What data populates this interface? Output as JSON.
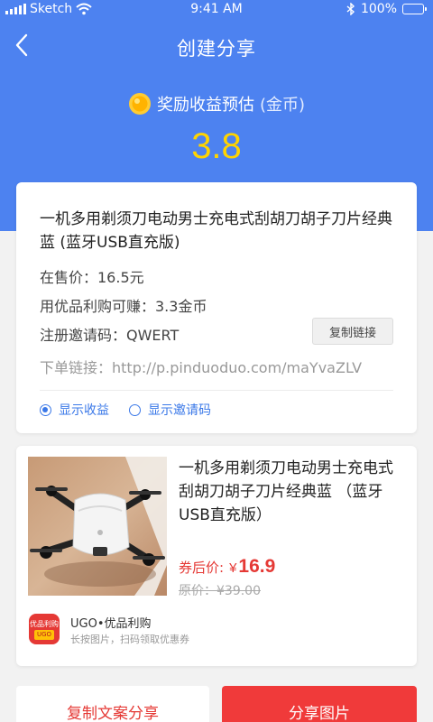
{
  "status_bar": {
    "carrier": "Sketch",
    "time": "9:41 AM",
    "battery": "100%"
  },
  "nav": {
    "title": "创建分享"
  },
  "reward": {
    "label": "奖励收益预估",
    "suffix": "(金币)",
    "value": "3.8"
  },
  "share_card": {
    "title": "一机多用剃须刀电动男士充电式刮胡刀胡子刀片经典蓝 (蓝牙USB直充版)",
    "price_line": "在售价：16.5元",
    "earn_line": "用优品利购可赚：3.3金币",
    "invite_line": "注册邀请码：QWERT",
    "copy_link_button": "复制链接",
    "link_line": "下单链接：http://p.pinduoduo.com/maYvaZLV",
    "option_show_earnings": "显示收益",
    "option_show_invite": "显示邀请码",
    "show_earnings_selected": true,
    "show_invite_selected": false
  },
  "product_card": {
    "title": "一机多用剃须刀电动男士充电式刮胡刀胡子刀片经典蓝 （蓝牙USB直充版）",
    "coupon_price_label": "券后价:",
    "coupon_price_currency": "¥",
    "coupon_price_value": "16.9",
    "original_price": "原价：¥39.00",
    "brand_logo_text": "优品利购",
    "brand_logo_tag": "UGO",
    "brand_name": "UGO•优品利购",
    "brand_tip": "长按图片，扫码领取优惠券"
  },
  "actions": {
    "copy_text_share": "复制文案分享",
    "share_image": "分享图片"
  },
  "colors": {
    "header_blue": "#4d82f0",
    "reward_yellow": "#ffd400",
    "accent_red": "#f03a3a",
    "link_blue": "#3a78e8"
  }
}
